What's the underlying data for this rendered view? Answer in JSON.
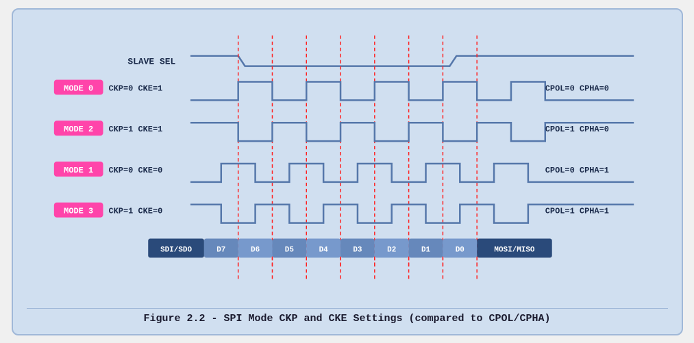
{
  "diagram": {
    "title": "Figure 2.2 - SPI Mode CKP and CKE Settings (compared to CPOL/CPHA)",
    "slave_sel_label": "SLAVE SEL",
    "modes": [
      {
        "label": "MODE 0",
        "params": "CKP=0  CKE=1",
        "right": "CPOL=0  CPHA=0"
      },
      {
        "label": "MODE 2",
        "params": "CKP=1  CKE=1",
        "right": "CPOL=1  CPHA=0"
      },
      {
        "label": "MODE 1",
        "params": "CKP=0  CKE=0",
        "right": "CPOL=0  CPHA=1"
      },
      {
        "label": "MODE 3",
        "params": "CKP=1  CKE=0",
        "right": "CPOL=1  CPHA=1"
      }
    ],
    "data_bits": [
      "SDI/SDO",
      "D7",
      "D6",
      "D5",
      "D4",
      "D3",
      "D2",
      "D1",
      "D0",
      "MOSI/MISO"
    ],
    "accent_color": "#ff44aa",
    "line_color": "#5577aa",
    "dashed_color": "#ff2222",
    "bg_color": "#c8d8ec"
  }
}
